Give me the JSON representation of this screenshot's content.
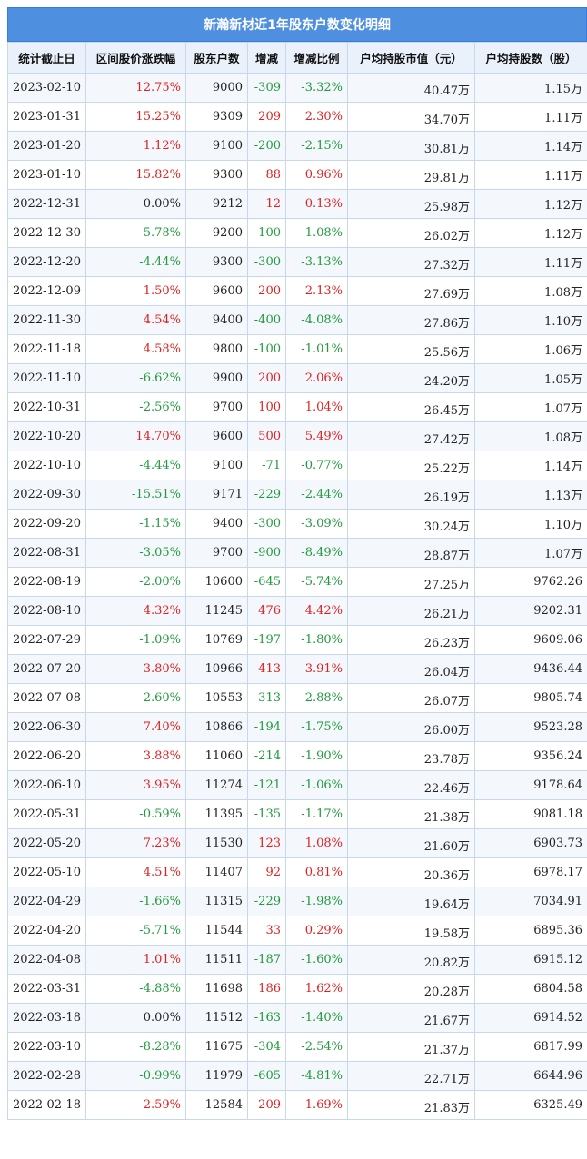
{
  "title": "新瀚新材近1年股东户数变化明细",
  "columns": [
    "统计截止日",
    "区间股价涨跌幅",
    "股东户数",
    "增减",
    "增减比例",
    "户均持股市值（元）",
    "户均持股数（股）"
  ],
  "rows": [
    {
      "date": "2023-02-10",
      "pct": "12.75%",
      "holders": "9000",
      "change": "-309",
      "ratio": "-3.32%",
      "mv": "40.47万",
      "avg": "1.15万"
    },
    {
      "date": "2023-01-31",
      "pct": "15.25%",
      "holders": "9309",
      "change": "209",
      "ratio": "2.30%",
      "mv": "34.70万",
      "avg": "1.11万"
    },
    {
      "date": "2023-01-20",
      "pct": "1.12%",
      "holders": "9100",
      "change": "-200",
      "ratio": "-2.15%",
      "mv": "30.81万",
      "avg": "1.14万"
    },
    {
      "date": "2023-01-10",
      "pct": "15.82%",
      "holders": "9300",
      "change": "88",
      "ratio": "0.96%",
      "mv": "29.81万",
      "avg": "1.11万"
    },
    {
      "date": "2022-12-31",
      "pct": "0.00%",
      "holders": "9212",
      "change": "12",
      "ratio": "0.13%",
      "mv": "25.98万",
      "avg": "1.12万"
    },
    {
      "date": "2022-12-30",
      "pct": "-5.78%",
      "holders": "9200",
      "change": "-100",
      "ratio": "-1.08%",
      "mv": "26.02万",
      "avg": "1.12万"
    },
    {
      "date": "2022-12-20",
      "pct": "-4.44%",
      "holders": "9300",
      "change": "-300",
      "ratio": "-3.13%",
      "mv": "27.32万",
      "avg": "1.11万"
    },
    {
      "date": "2022-12-09",
      "pct": "1.50%",
      "holders": "9600",
      "change": "200",
      "ratio": "2.13%",
      "mv": "27.69万",
      "avg": "1.08万"
    },
    {
      "date": "2022-11-30",
      "pct": "4.54%",
      "holders": "9400",
      "change": "-400",
      "ratio": "-4.08%",
      "mv": "27.86万",
      "avg": "1.10万"
    },
    {
      "date": "2022-11-18",
      "pct": "4.58%",
      "holders": "9800",
      "change": "-100",
      "ratio": "-1.01%",
      "mv": "25.56万",
      "avg": "1.06万"
    },
    {
      "date": "2022-11-10",
      "pct": "-6.62%",
      "holders": "9900",
      "change": "200",
      "ratio": "2.06%",
      "mv": "24.20万",
      "avg": "1.05万"
    },
    {
      "date": "2022-10-31",
      "pct": "-2.56%",
      "holders": "9700",
      "change": "100",
      "ratio": "1.04%",
      "mv": "26.45万",
      "avg": "1.07万"
    },
    {
      "date": "2022-10-20",
      "pct": "14.70%",
      "holders": "9600",
      "change": "500",
      "ratio": "5.49%",
      "mv": "27.42万",
      "avg": "1.08万"
    },
    {
      "date": "2022-10-10",
      "pct": "-4.44%",
      "holders": "9100",
      "change": "-71",
      "ratio": "-0.77%",
      "mv": "25.22万",
      "avg": "1.14万"
    },
    {
      "date": "2022-09-30",
      "pct": "-15.51%",
      "holders": "9171",
      "change": "-229",
      "ratio": "-2.44%",
      "mv": "26.19万",
      "avg": "1.13万"
    },
    {
      "date": "2022-09-20",
      "pct": "-1.15%",
      "holders": "9400",
      "change": "-300",
      "ratio": "-3.09%",
      "mv": "30.24万",
      "avg": "1.10万"
    },
    {
      "date": "2022-08-31",
      "pct": "-3.05%",
      "holders": "9700",
      "change": "-900",
      "ratio": "-8.49%",
      "mv": "28.87万",
      "avg": "1.07万"
    },
    {
      "date": "2022-08-19",
      "pct": "-2.00%",
      "holders": "10600",
      "change": "-645",
      "ratio": "-5.74%",
      "mv": "27.25万",
      "avg": "9762.26"
    },
    {
      "date": "2022-08-10",
      "pct": "4.32%",
      "holders": "11245",
      "change": "476",
      "ratio": "4.42%",
      "mv": "26.21万",
      "avg": "9202.31"
    },
    {
      "date": "2022-07-29",
      "pct": "-1.09%",
      "holders": "10769",
      "change": "-197",
      "ratio": "-1.80%",
      "mv": "26.23万",
      "avg": "9609.06"
    },
    {
      "date": "2022-07-20",
      "pct": "3.80%",
      "holders": "10966",
      "change": "413",
      "ratio": "3.91%",
      "mv": "26.04万",
      "avg": "9436.44"
    },
    {
      "date": "2022-07-08",
      "pct": "-2.60%",
      "holders": "10553",
      "change": "-313",
      "ratio": "-2.88%",
      "mv": "26.07万",
      "avg": "9805.74"
    },
    {
      "date": "2022-06-30",
      "pct": "7.40%",
      "holders": "10866",
      "change": "-194",
      "ratio": "-1.75%",
      "mv": "26.00万",
      "avg": "9523.28"
    },
    {
      "date": "2022-06-20",
      "pct": "3.88%",
      "holders": "11060",
      "change": "-214",
      "ratio": "-1.90%",
      "mv": "23.78万",
      "avg": "9356.24"
    },
    {
      "date": "2022-06-10",
      "pct": "3.95%",
      "holders": "11274",
      "change": "-121",
      "ratio": "-1.06%",
      "mv": "22.46万",
      "avg": "9178.64"
    },
    {
      "date": "2022-05-31",
      "pct": "-0.59%",
      "holders": "11395",
      "change": "-135",
      "ratio": "-1.17%",
      "mv": "21.38万",
      "avg": "9081.18"
    },
    {
      "date": "2022-05-20",
      "pct": "7.23%",
      "holders": "11530",
      "change": "123",
      "ratio": "1.08%",
      "mv": "21.60万",
      "avg": "6903.73"
    },
    {
      "date": "2022-05-10",
      "pct": "4.51%",
      "holders": "11407",
      "change": "92",
      "ratio": "0.81%",
      "mv": "20.36万",
      "avg": "6978.17"
    },
    {
      "date": "2022-04-29",
      "pct": "-1.66%",
      "holders": "11315",
      "change": "-229",
      "ratio": "-1.98%",
      "mv": "19.64万",
      "avg": "7034.91"
    },
    {
      "date": "2022-04-20",
      "pct": "-5.71%",
      "holders": "11544",
      "change": "33",
      "ratio": "0.29%",
      "mv": "19.58万",
      "avg": "6895.36"
    },
    {
      "date": "2022-04-08",
      "pct": "1.01%",
      "holders": "11511",
      "change": "-187",
      "ratio": "-1.60%",
      "mv": "20.82万",
      "avg": "6915.12"
    },
    {
      "date": "2022-03-31",
      "pct": "-4.88%",
      "holders": "11698",
      "change": "186",
      "ratio": "1.62%",
      "mv": "20.28万",
      "avg": "6804.58"
    },
    {
      "date": "2022-03-18",
      "pct": "0.00%",
      "holders": "11512",
      "change": "-163",
      "ratio": "-1.40%",
      "mv": "21.67万",
      "avg": "6914.52"
    },
    {
      "date": "2022-03-10",
      "pct": "-8.28%",
      "holders": "11675",
      "change": "-304",
      "ratio": "-2.54%",
      "mv": "21.37万",
      "avg": "6817.99"
    },
    {
      "date": "2022-02-28",
      "pct": "-0.99%",
      "holders": "11979",
      "change": "-605",
      "ratio": "-4.81%",
      "mv": "22.71万",
      "avg": "6644.96"
    },
    {
      "date": "2022-02-18",
      "pct": "2.59%",
      "holders": "12584",
      "change": "209",
      "ratio": "1.69%",
      "mv": "21.83万",
      "avg": "6325.49"
    }
  ],
  "colors": {
    "up": "#e01f1f",
    "down": "#1f9a3c",
    "header": "#4f8fe0"
  }
}
